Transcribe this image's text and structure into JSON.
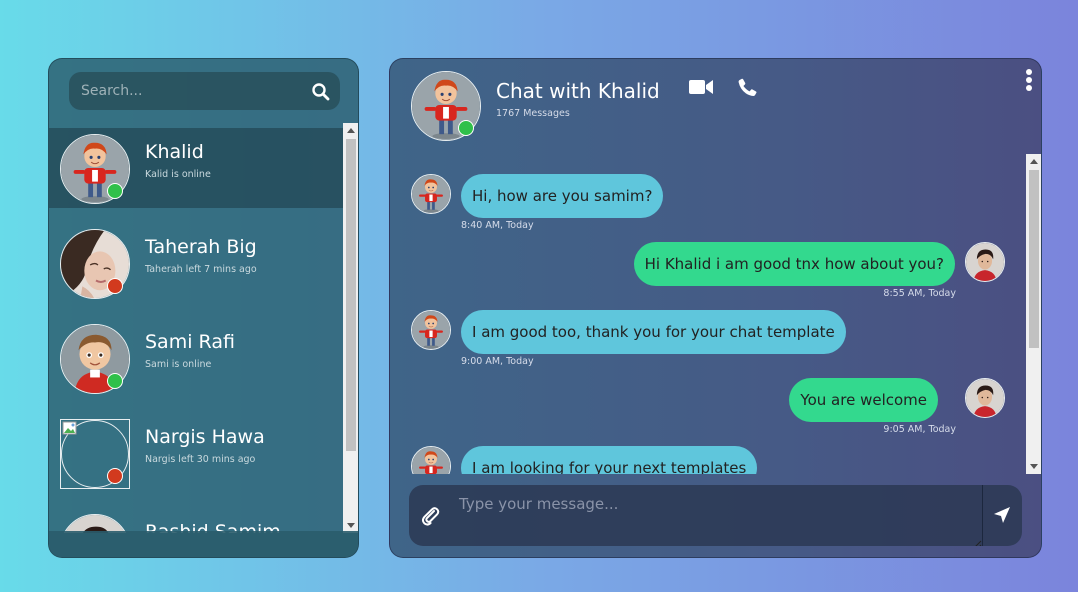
{
  "search": {
    "placeholder": "Search..."
  },
  "contacts": [
    {
      "name": "Khalid",
      "status": "Kalid is online",
      "presence": "online",
      "avatar": "cartoon-boy-avatar",
      "active": true
    },
    {
      "name": "Taherah Big",
      "status": "Taherah left 7 mins ago",
      "presence": "offline",
      "avatar": "woman-photo-avatar",
      "active": false
    },
    {
      "name": "Sami Rafi",
      "status": "Sami is online",
      "presence": "online",
      "avatar": "cartoon-boy-brown-hair-avatar",
      "active": false
    },
    {
      "name": "Nargis Hawa",
      "status": "Nargis left 30 mins ago",
      "presence": "offline",
      "avatar": "broken-image-avatar",
      "active": false
    },
    {
      "name": "Rashid Samim",
      "status": "",
      "presence": "",
      "avatar": "man-photo-avatar",
      "active": false
    }
  ],
  "chat": {
    "title": "Chat with Khalid",
    "count": "1767 Messages",
    "input_placeholder": "Type your message...",
    "messages": [
      {
        "direction": "in",
        "text": "Hi, how are you samim?",
        "time": "8:40 AM, Today"
      },
      {
        "direction": "out",
        "text": "Hi Khalid i am good tnx how about you?",
        "time": "8:55 AM, Today"
      },
      {
        "direction": "in",
        "text": "I am good too, thank you for your chat template",
        "time": "9:00 AM, Today"
      },
      {
        "direction": "out",
        "text": "You are welcome",
        "time": "9:05 AM, Today"
      },
      {
        "direction": "in",
        "text": "I am looking for your next templates",
        "time": ""
      }
    ]
  },
  "colors": {
    "incoming_bubble": "#5fc6dc",
    "outgoing_bubble": "#33d98e",
    "online": "#30c04a",
    "offline": "#d23a1e"
  },
  "icons": [
    "search-icon",
    "video-camera-icon",
    "phone-icon",
    "more-vertical-icon",
    "paperclip-icon",
    "send-arrow-icon"
  ]
}
